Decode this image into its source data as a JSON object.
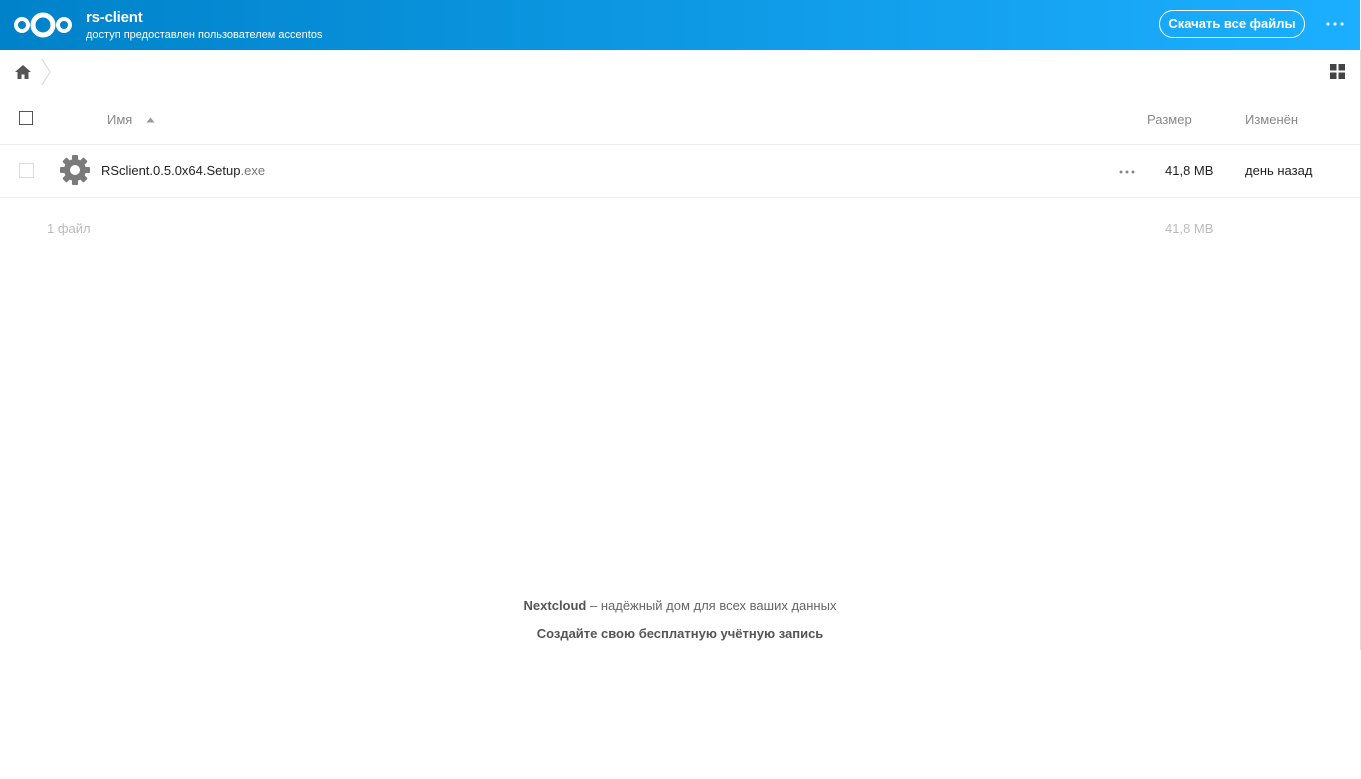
{
  "header": {
    "title": "rs-client",
    "subtitle": "доступ предоставлен пользователем accentos",
    "download_label": "Скачать все файлы",
    "brand_color": "#0082c9"
  },
  "breadcrumb": {
    "home_icon": "home-icon"
  },
  "table": {
    "columns": {
      "name": "Имя",
      "size": "Размер",
      "modified": "Изменён"
    },
    "sort": {
      "column": "name",
      "direction": "ascending"
    },
    "rows": [
      {
        "name": "RSclient.0.5.0x64.Setup",
        "ext": ".exe",
        "icon": "gear-icon",
        "size": "41,8 MB",
        "modified": "день назад"
      }
    ],
    "summary": {
      "count": "1 файл",
      "size": "41,8 MB"
    }
  },
  "footer": {
    "brand": "Nextcloud",
    "tagline": " – надёжный дом для всех ваших данных",
    "signup": "Создайте свою бесплатную учётную запись"
  }
}
